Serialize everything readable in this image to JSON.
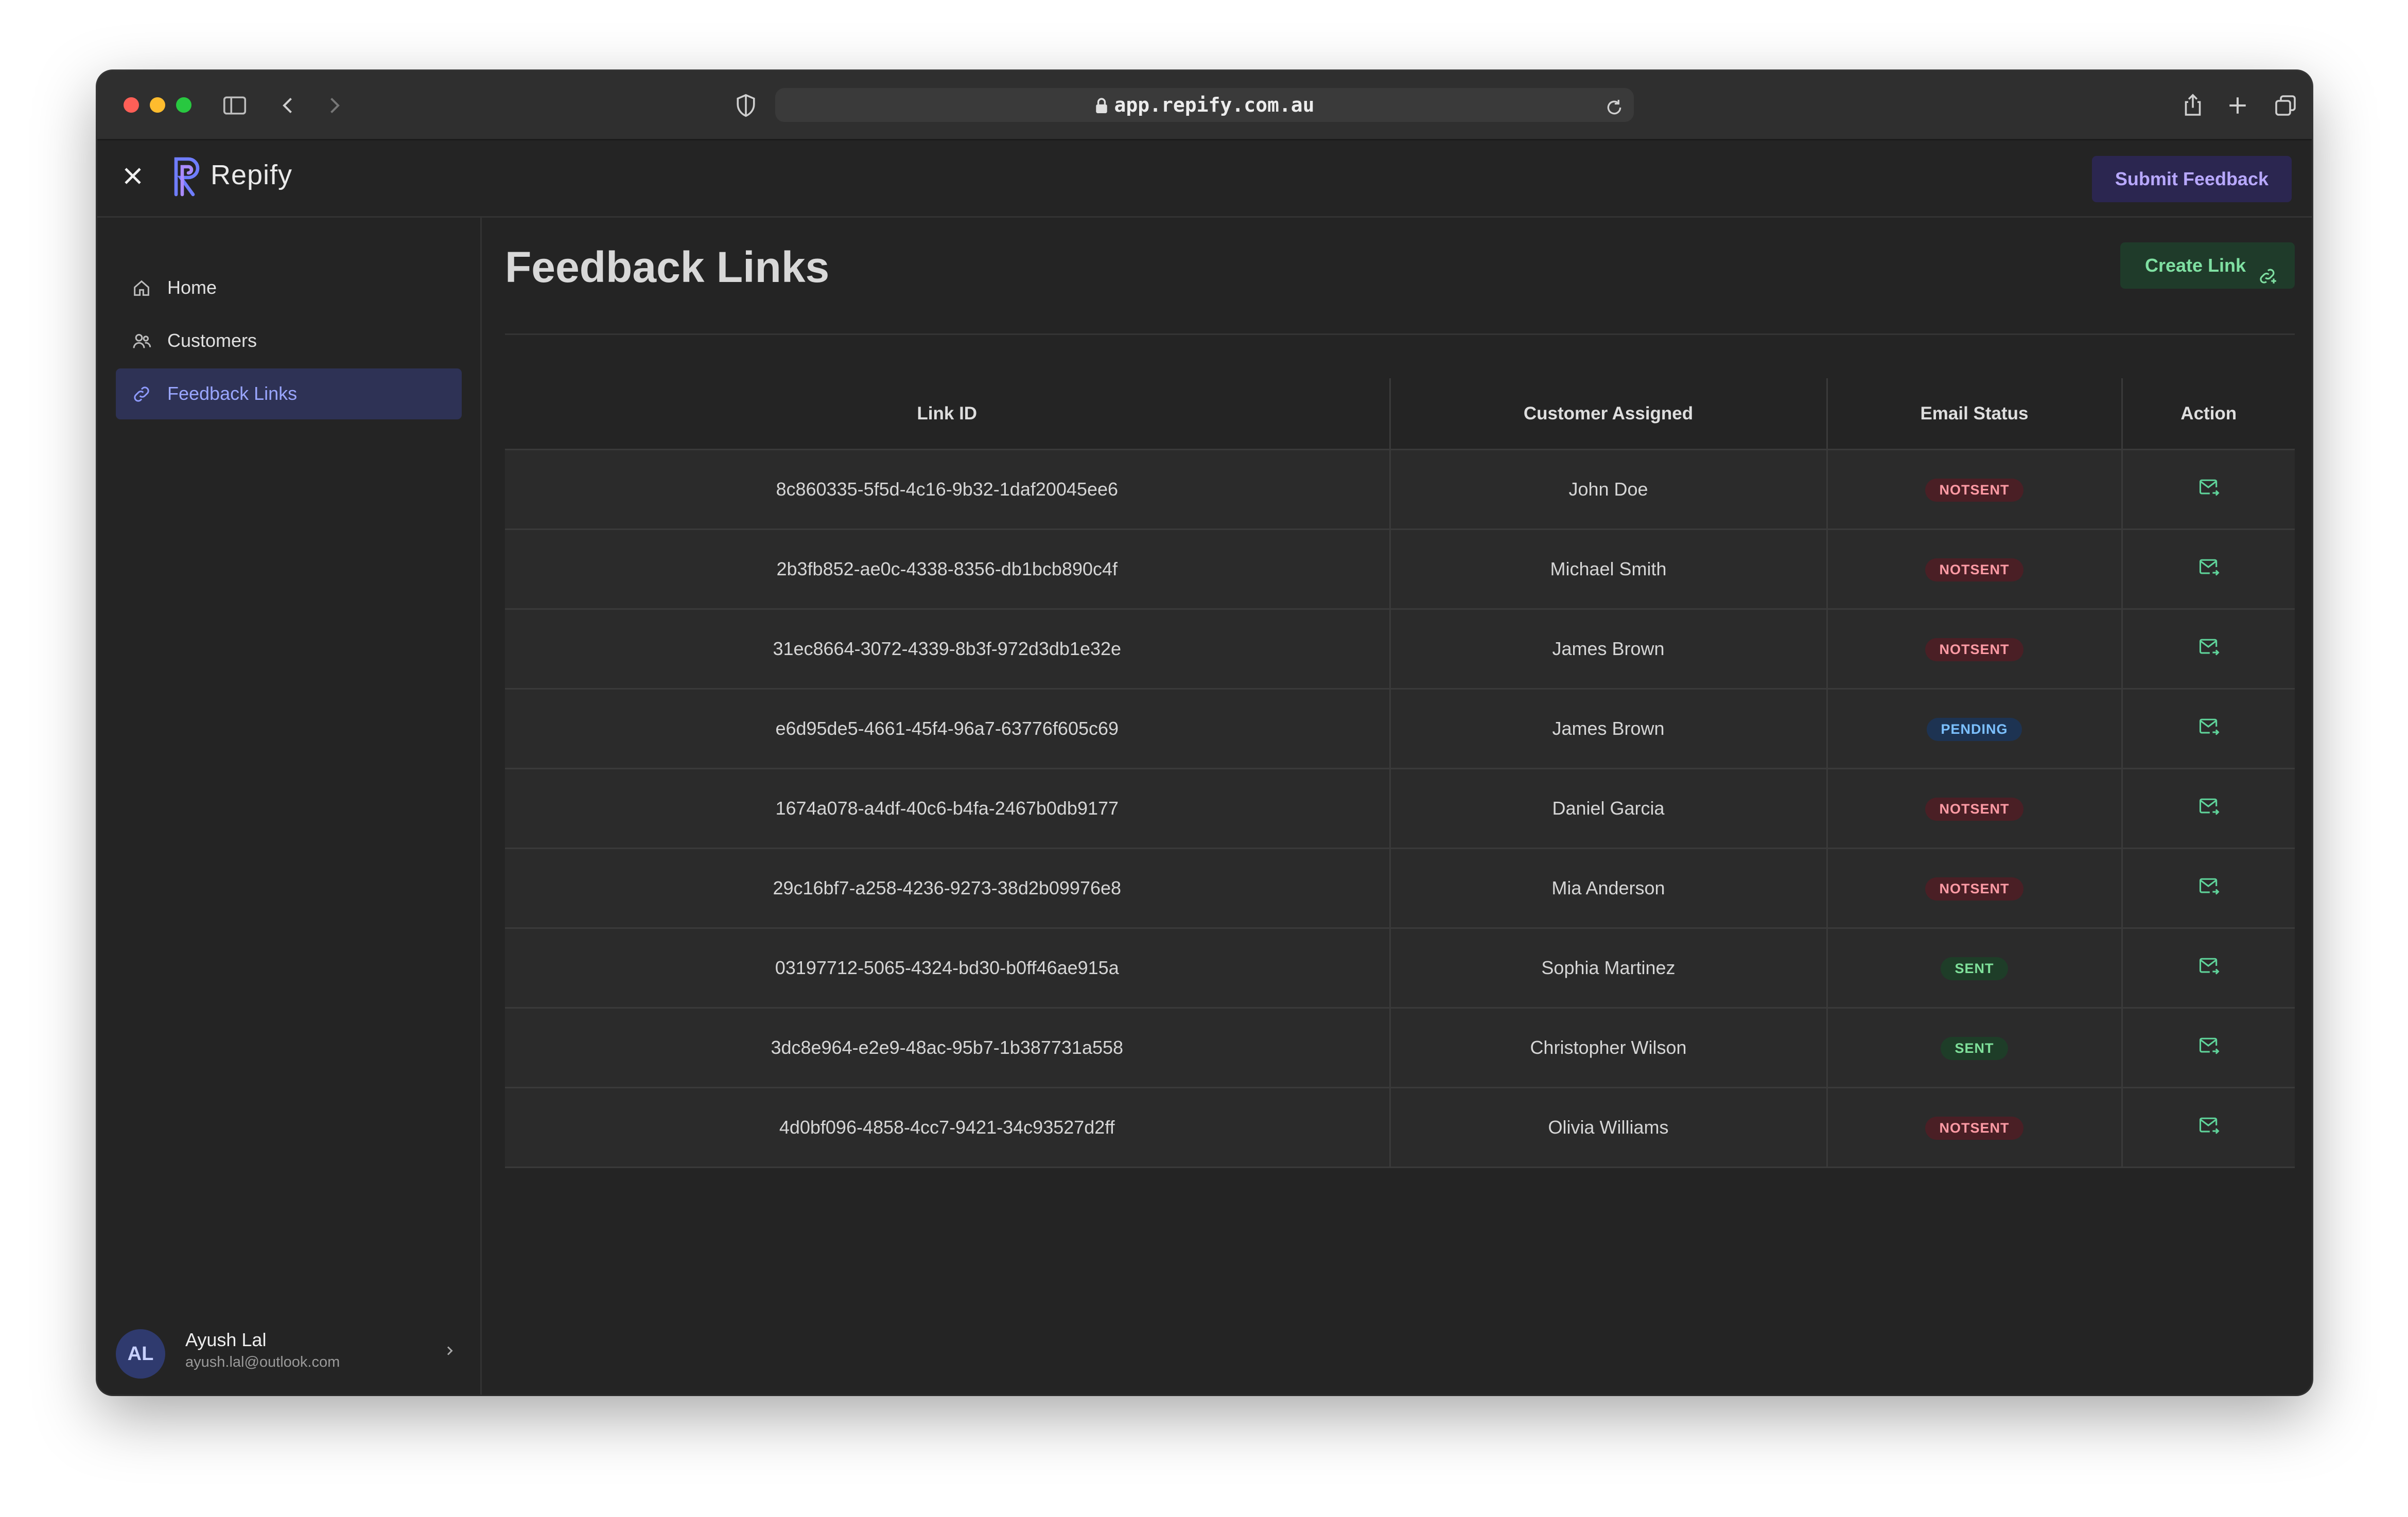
{
  "browser": {
    "url": "app.repify.com.au"
  },
  "app": {
    "brand": "Repify",
    "submit_label": "Submit Feedback"
  },
  "sidebar": {
    "items": [
      {
        "label": "Home",
        "icon": "home-icon",
        "active": false
      },
      {
        "label": "Customers",
        "icon": "users-icon",
        "active": false
      },
      {
        "label": "Feedback Links",
        "icon": "link-icon",
        "active": true
      }
    ],
    "user": {
      "initials": "AL",
      "name": "Ayush Lal",
      "email": "ayush.lal@outlook.com"
    }
  },
  "main": {
    "title": "Feedback Links",
    "create_label": "Create Link",
    "table": {
      "headers": [
        "Link ID",
        "Customer Assigned",
        "Email Status",
        "Action"
      ],
      "rows": [
        {
          "id": "8c860335-5f5d-4c16-9b32-1daf20045ee6",
          "customer": "John Doe",
          "status": "NOTSENT"
        },
        {
          "id": "2b3fb852-ae0c-4338-8356-db1bcb890c4f",
          "customer": "Michael Smith",
          "status": "NOTSENT"
        },
        {
          "id": "31ec8664-3072-4339-8b3f-972d3db1e32e",
          "customer": "James Brown",
          "status": "NOTSENT"
        },
        {
          "id": "e6d95de5-4661-45f4-96a7-63776f605c69",
          "customer": "James Brown",
          "status": "PENDING"
        },
        {
          "id": "1674a078-a4df-40c6-b4fa-2467b0db9177",
          "customer": "Daniel Garcia",
          "status": "NOTSENT"
        },
        {
          "id": "29c16bf7-a258-4236-9273-38d2b09976e8",
          "customer": "Mia Anderson",
          "status": "NOTSENT"
        },
        {
          "id": "03197712-5065-4324-bd30-b0ff46ae915a",
          "customer": "Sophia Martinez",
          "status": "SENT"
        },
        {
          "id": "3dc8e964-e2e9-48ac-95b7-1b387731a558",
          "customer": "Christopher Wilson",
          "status": "SENT"
        },
        {
          "id": "4d0bf096-4858-4cc7-9421-34c93527d2ff",
          "customer": "Olivia Williams",
          "status": "NOTSENT"
        }
      ]
    }
  },
  "colors": {
    "accent_purple": "#b8a8ff",
    "accent_green": "#7fe0a2",
    "notsent": "#ff9ba5",
    "pending": "#7cc0ff",
    "sent": "#7fe09a"
  }
}
